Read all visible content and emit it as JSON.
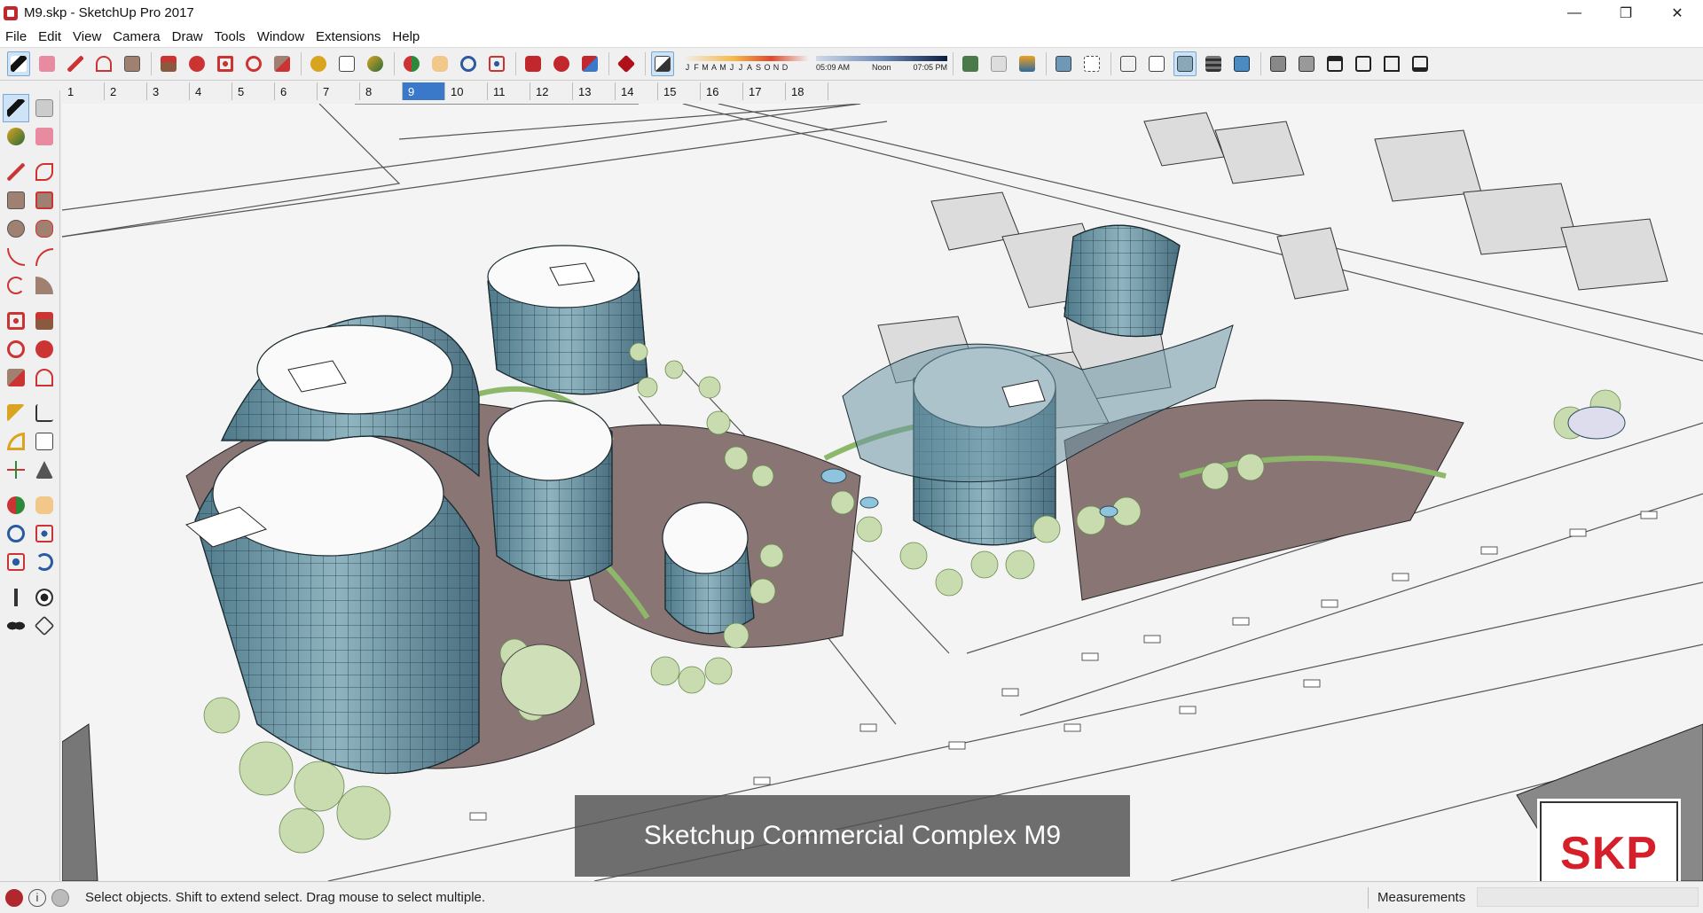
{
  "window": {
    "title": "M9.skp - SketchUp Pro 2017",
    "minimize": "—",
    "maximize": "❐",
    "close": "✕"
  },
  "menu": [
    "File",
    "Edit",
    "View",
    "Camera",
    "Draw",
    "Tools",
    "Window",
    "Extensions",
    "Help"
  ],
  "shadow": {
    "months": [
      "J",
      "F",
      "M",
      "A",
      "M",
      "J",
      "J",
      "A",
      "S",
      "O",
      "N",
      "D"
    ],
    "time_start": "05:09 AM",
    "time_mid": "Noon",
    "time_end": "07:05 PM"
  },
  "scenes": [
    "1",
    "2",
    "3",
    "4",
    "5",
    "6",
    "7",
    "8",
    "9",
    "10",
    "11",
    "12",
    "13",
    "14",
    "15",
    "16",
    "17",
    "18"
  ],
  "active_scene": "9",
  "viewport": {
    "caption": "Sketchup Commercial Complex M9",
    "watermark": "SKP"
  },
  "status": {
    "message": "Select objects. Shift to extend select. Drag mouse to select multiple.",
    "measurements_label": "Measurements",
    "measurements_value": ""
  },
  "icons": {
    "toolbar": [
      "select-icon",
      "eraser-icon",
      "pencil-icon",
      "arc-icon",
      "rectangle-icon",
      "push-pull-icon",
      "follow-me-icon",
      "move-icon",
      "rotate-icon",
      "scale-icon",
      "tape-measure-icon",
      "text-icon",
      "paint-bucket-icon",
      "orbit-icon",
      "pan-icon",
      "zoom-icon",
      "zoom-extents-icon",
      "warehouse-icon",
      "extension-warehouse-icon",
      "layout-icon",
      "ruby-icon",
      "shadows-icon",
      "location-icon",
      "styles-icon",
      "layers-icon",
      "xray-icon",
      "back-edges-icon",
      "wireframe-icon",
      "hidden-line-icon",
      "shaded-icon",
      "textured-icon",
      "monochrome-icon",
      "iso-view-icon",
      "top-view-icon",
      "front-view-icon",
      "right-view-icon",
      "back-view-icon",
      "left-view-icon"
    ],
    "palette": [
      "select-icon",
      "make-component-icon",
      "paint-bucket-icon",
      "eraser-icon",
      "line-icon",
      "freehand-icon",
      "rectangle-icon",
      "rotated-rectangle-icon",
      "circle-icon",
      "polygon-icon",
      "arc-icon",
      "two-point-arc-icon",
      "three-point-arc-icon",
      "pie-icon",
      "move-icon",
      "push-pull-icon",
      "rotate-icon",
      "follow-me-icon",
      "scale-icon",
      "offset-icon",
      "tape-measure-icon",
      "dimension-icon",
      "protractor-icon",
      "text-icon",
      "axes-icon",
      "3d-text-icon",
      "orbit-icon",
      "pan-icon",
      "zoom-icon",
      "zoom-window-icon",
      "zoom-extents-icon",
      "previous-view-icon",
      "position-camera-icon",
      "look-around-icon",
      "walk-icon",
      "section-plane-icon"
    ]
  },
  "colors": {
    "accent": "#3a79c9",
    "glass": "#6f98a6",
    "watermark_red": "#d4202a"
  }
}
